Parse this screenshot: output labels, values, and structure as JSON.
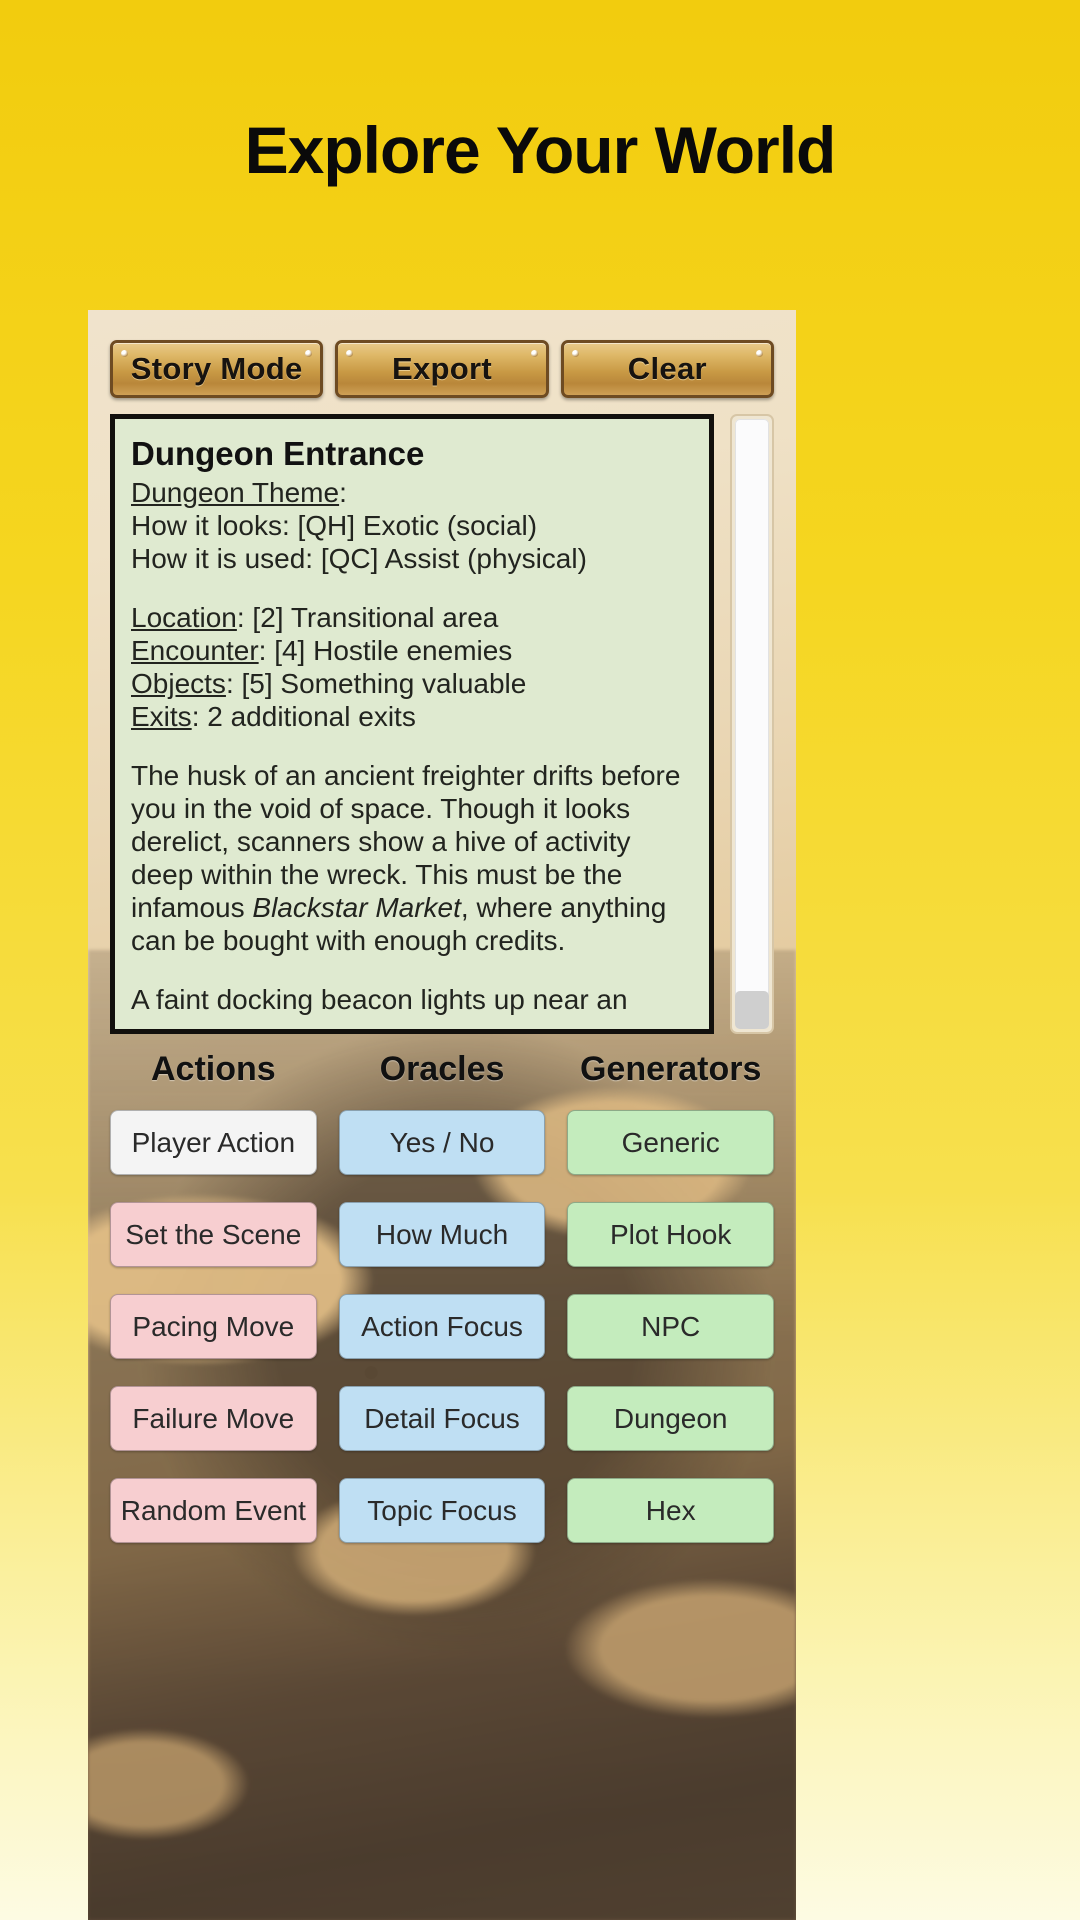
{
  "headline": {
    "title": "Explore Your World"
  },
  "toolbar": {
    "buttons": [
      {
        "label": "Story Mode",
        "name": "story-mode-button"
      },
      {
        "label": "Export",
        "name": "export-button"
      },
      {
        "label": "Clear",
        "name": "clear-button"
      }
    ]
  },
  "story": {
    "heading": "Dungeon Entrance",
    "theme_label": "Dungeon Theme",
    "theme_colon": ":",
    "how_it_looks": "How it looks: [QH] Exotic (social)",
    "how_it_is_used": "How it is used: [QC] Assist (physical)",
    "fields": [
      {
        "label": "Location",
        "value": ": [2] Transitional area"
      },
      {
        "label": "Encounter",
        "value": ": [4] Hostile enemies"
      },
      {
        "label": "Objects",
        "value": ": [5] Something valuable"
      },
      {
        "label": "Exits",
        "value": ": 2 additional exits"
      }
    ],
    "paragraph_1_a": "The husk of an ancient freighter drifts before you in the void of space.  Though it looks derelict, scanners show a hive of activity deep within the wreck.  This must be the infamous ",
    "paragraph_1_italic": "Blackstar Market",
    "paragraph_1_b": ", where anything can be bought with enough credits.",
    "paragraph_2": "A faint docking beacon lights up near an"
  },
  "columns": [
    {
      "header": "Actions",
      "name": "column-actions",
      "buttons": [
        {
          "label": "Player Action",
          "style": "pad-white"
        },
        {
          "label": "Set the Scene",
          "style": "pad-pink"
        },
        {
          "label": "Pacing Move",
          "style": "pad-pink"
        },
        {
          "label": "Failure Move",
          "style": "pad-pink"
        },
        {
          "label": "Random Event",
          "style": "pad-pink"
        }
      ]
    },
    {
      "header": "Oracles",
      "name": "column-oracles",
      "buttons": [
        {
          "label": "Yes / No",
          "style": "pad-blue"
        },
        {
          "label": "How Much",
          "style": "pad-blue"
        },
        {
          "label": "Action Focus",
          "style": "pad-blue"
        },
        {
          "label": "Detail Focus",
          "style": "pad-blue"
        },
        {
          "label": "Topic Focus",
          "style": "pad-blue"
        }
      ]
    },
    {
      "header": "Generators",
      "name": "column-generators",
      "buttons": [
        {
          "label": "Generic",
          "style": "pad-green"
        },
        {
          "label": "Plot Hook",
          "style": "pad-green"
        },
        {
          "label": "NPC",
          "style": "pad-green"
        },
        {
          "label": "Dungeon",
          "style": "pad-green"
        },
        {
          "label": "Hex",
          "style": "pad-green"
        }
      ]
    }
  ],
  "colors": {
    "background_top": "#f2cc0e",
    "background_bottom": "#fdfbe3",
    "story_panel": "#dfead0",
    "toolbar_button": "#c99a45",
    "action_pink": "#f7ced0",
    "oracle_blue": "#bfdff3",
    "generator_green": "#c4ecbd"
  }
}
